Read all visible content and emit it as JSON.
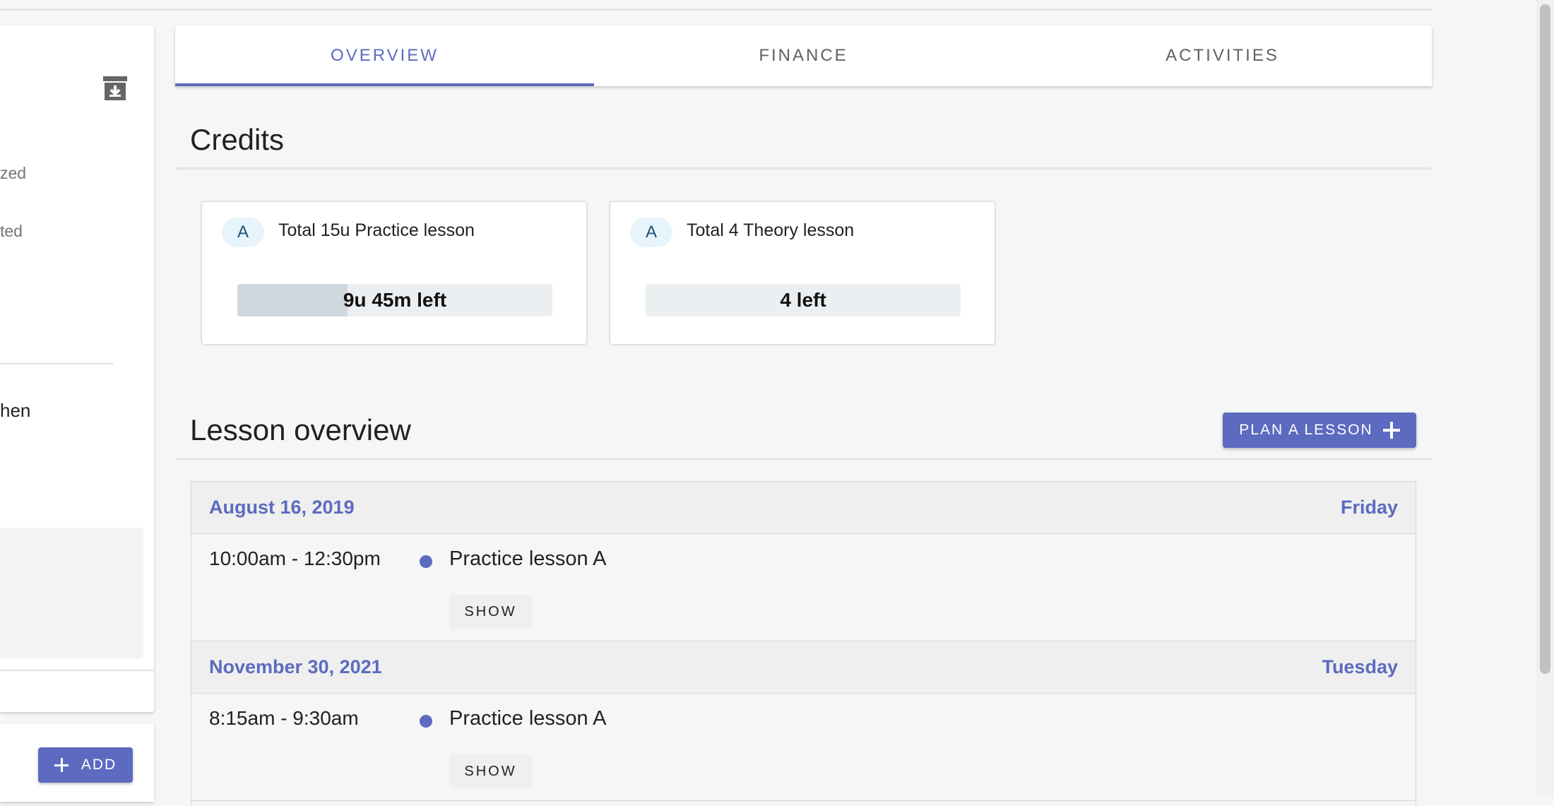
{
  "left_panel": {
    "fragments": [
      "zed",
      "ted"
    ],
    "name_fragment": "hen",
    "add_button_label": "ADD"
  },
  "tabs": [
    {
      "label": "OVERVIEW",
      "active": true
    },
    {
      "label": "FINANCE",
      "active": false
    },
    {
      "label": "ACTIVITIES",
      "active": false
    }
  ],
  "credits": {
    "title": "Credits",
    "cards": [
      {
        "avatar": "A",
        "title": "Total 15u Practice lesson",
        "remaining_label": "9u 45m left",
        "used_fraction": 0.35
      },
      {
        "avatar": "A",
        "title": "Total 4 Theory lesson",
        "remaining_label": "4 left",
        "used_fraction": 0
      }
    ]
  },
  "lessons": {
    "title": "Lesson overview",
    "plan_button_label": "PLAN A LESSON",
    "days": [
      {
        "date": "August 16, 2019",
        "weekday": "Friday",
        "time": "10:00am - 12:30pm",
        "lesson": "Practice lesson A",
        "show_label": "SHOW"
      },
      {
        "date": "November 30, 2021",
        "weekday": "Tuesday",
        "time": "8:15am - 9:30am",
        "lesson": "Practice lesson A",
        "show_label": "SHOW"
      }
    ]
  },
  "colors": {
    "accent": "#5c6bc0",
    "background": "#f5f6f6"
  },
  "icons": [
    "archive-icon",
    "plus-icon"
  ]
}
